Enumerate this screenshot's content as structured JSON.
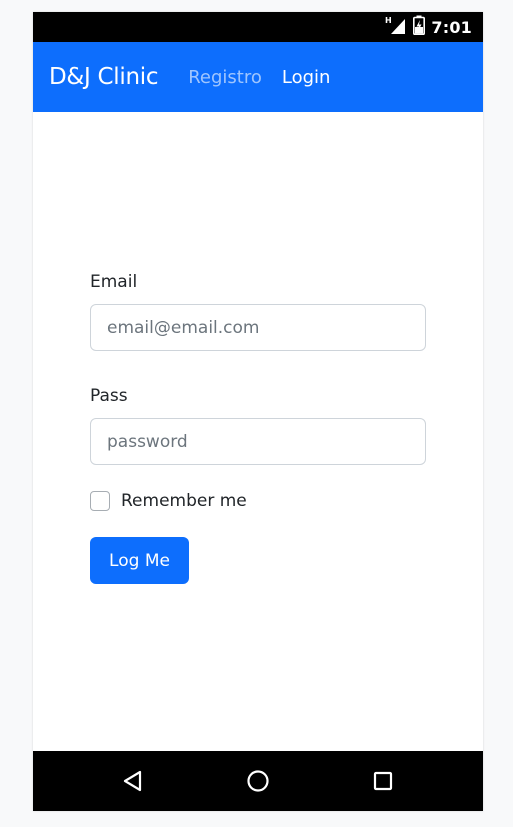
{
  "status_bar": {
    "time": "7:01",
    "icons": [
      "signal-h-icon",
      "battery-charging-icon"
    ],
    "signal_label": "H"
  },
  "navbar": {
    "brand": "D&J Clinic",
    "links": [
      {
        "label": "Registro",
        "active": false
      },
      {
        "label": "Login",
        "active": true
      }
    ]
  },
  "form": {
    "email_label": "Email",
    "email_placeholder": "email@email.com",
    "email_value": "",
    "pass_label": "Pass",
    "pass_placeholder": "password",
    "pass_value": "",
    "remember_label": "Remember me",
    "remember_checked": false,
    "submit_label": "Log Me"
  },
  "system_nav": {
    "buttons": [
      "back-icon",
      "home-icon",
      "recents-icon"
    ]
  },
  "colors": {
    "primary": "#0d6efd",
    "status_bar": "#000000",
    "background": "#f8f9fa",
    "text": "#212529",
    "placeholder": "#6c757d",
    "inactive_link": "rgba(255,255,255,0.6)"
  }
}
